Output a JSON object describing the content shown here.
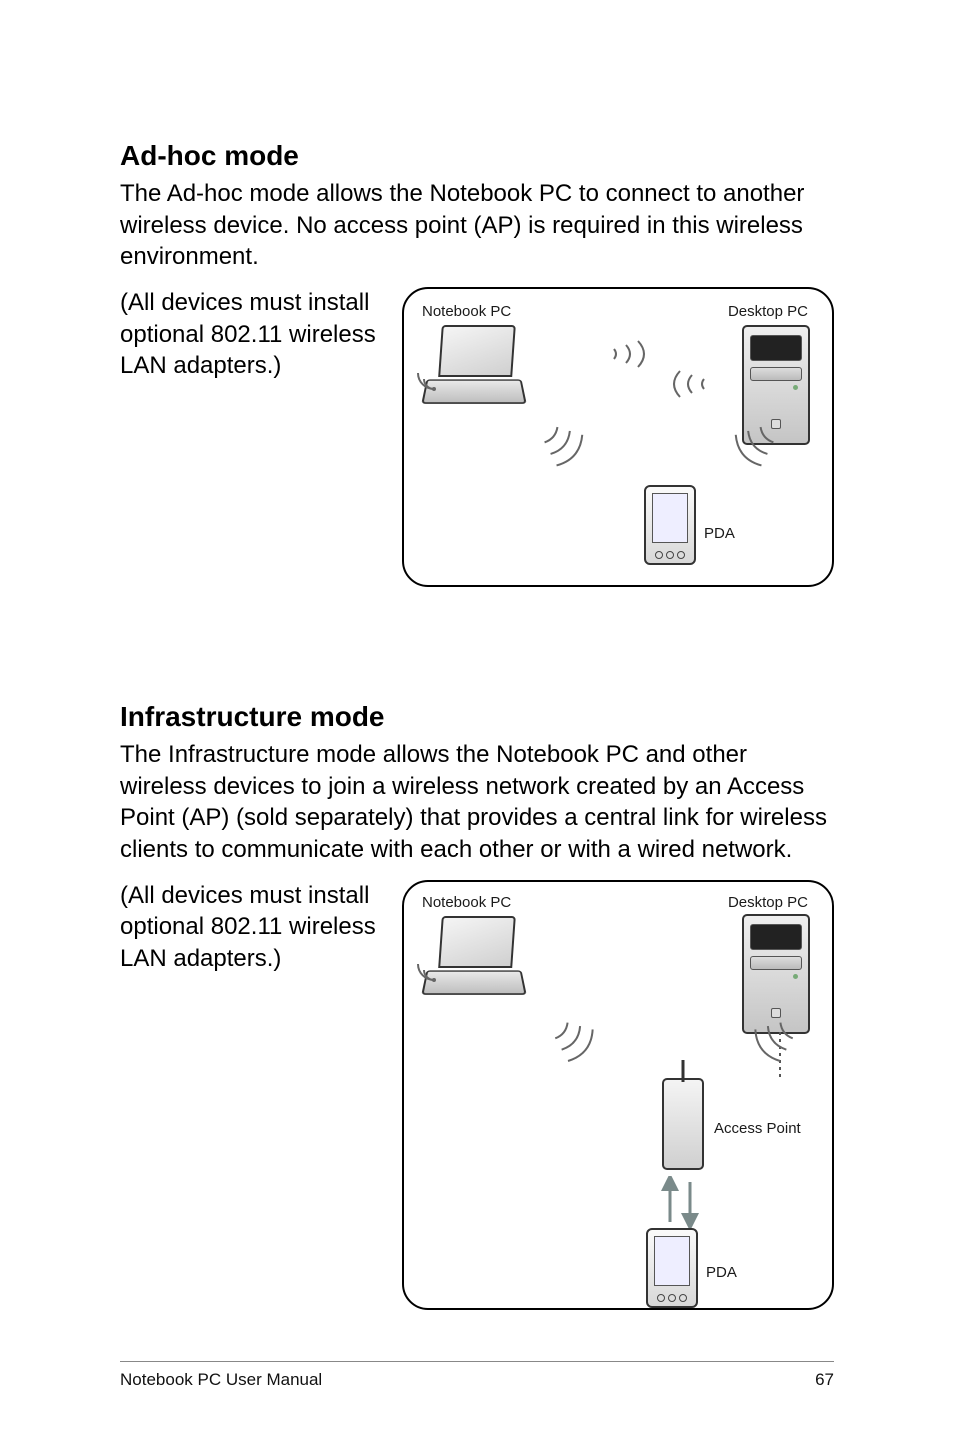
{
  "section1": {
    "heading": "Ad-hoc mode",
    "body": "The Ad-hoc mode allows the Notebook PC to connect to another wireless device. No access point (AP) is required in this wireless environment.",
    "side": "(All devices must install optional 802.11 wireless LAN adapters.)",
    "labels": {
      "notebook": "Notebook PC",
      "desktop": "Desktop PC",
      "pda": "PDA"
    }
  },
  "section2": {
    "heading": "Infrastructure mode",
    "body": "The Infrastructure mode allows the Notebook PC and other wireless devices to join a wireless network created by an Access Point (AP) (sold separately) that provides a central link for wireless clients to communicate with each other or with a wired network.",
    "side": "(All devices must install optional 802.11 wireless LAN adapters.)",
    "labels": {
      "notebook": "Notebook PC",
      "desktop": "Desktop PC",
      "ap": "Access Point",
      "pda": "PDA"
    }
  },
  "footer": {
    "left": "Notebook PC User Manual",
    "page": "67"
  }
}
